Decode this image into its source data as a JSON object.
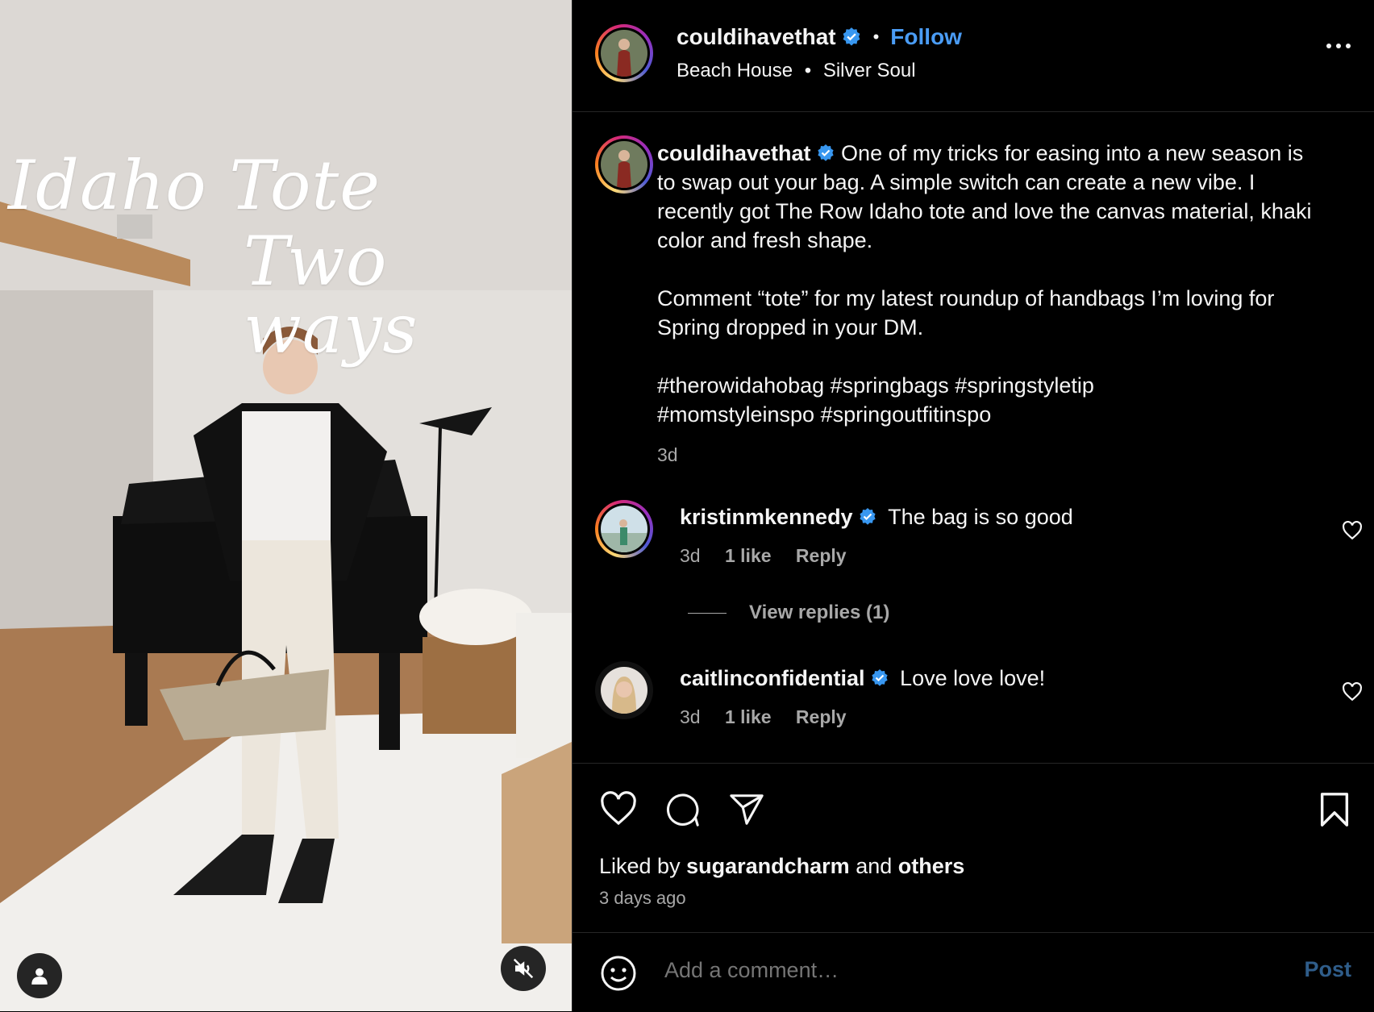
{
  "media": {
    "overlay_line1": "Idaho Tote",
    "overlay_line2": "Two ways"
  },
  "header": {
    "username": "couldihavethat",
    "follow_label": "Follow",
    "separator": "•",
    "audio_artist": "Beach House",
    "audio_track": "Silver Soul"
  },
  "caption": {
    "username": "couldihavethat",
    "para1": "One of my tricks for easing into a new season is to swap out your bag. A simple switch can create a new vibe. I recently got The Row Idaho tote and love the canvas material, khaki color and fresh shape.",
    "para2": "Comment “tote” for my latest roundup of handbags I’m loving for Spring dropped in your DM.",
    "hashtags_line1": "#therowidahobag #springbags #springstyletip",
    "hashtags_line2": "#momstyleinspo #springoutfitinspo",
    "time": "3d"
  },
  "comments": [
    {
      "username": "kristinmkennedy",
      "text": "The bag is so good",
      "time": "3d",
      "likes": "1 like",
      "reply": "Reply"
    },
    {
      "username": "caitlinconfidential",
      "text": "Love love love!",
      "time": "3d",
      "likes": "1 like",
      "reply": "Reply"
    }
  ],
  "view_replies": "View replies (1)",
  "likes": {
    "prefix": "Liked by",
    "user": "sugarandcharm",
    "mid": "and",
    "others": "others",
    "date": "3 days ago"
  },
  "add_comment": {
    "placeholder": "Add a comment…",
    "post_label": "Post"
  },
  "colors": {
    "accent_blue": "#4a9cf5",
    "verified_blue": "#3897f0",
    "post_disabled": "#2f5d8a",
    "secondary_text": "#a8a8a8"
  },
  "icons": [
    "user-icon",
    "mute-icon",
    "verified-icon",
    "more-icon",
    "heart-icon",
    "comment-icon",
    "share-icon",
    "bookmark-icon",
    "emoji-icon"
  ]
}
